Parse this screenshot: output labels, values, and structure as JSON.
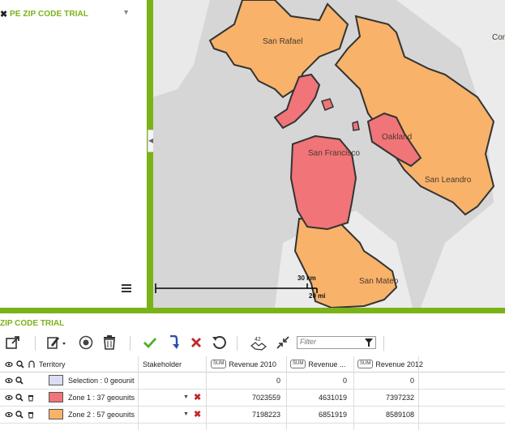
{
  "layer_panel": {
    "layer_name": "PE ZIP CODE TRIAL"
  },
  "map": {
    "labels": {
      "san_rafael": "San Rafael",
      "san_francisco": "San Francisco",
      "oakland": "Oakland",
      "san_leandro": "San Leandro",
      "san_mateo": "San Mateo",
      "concord_partial": "Con"
    },
    "scale": {
      "km": "30 km",
      "mi": "20 mi"
    },
    "colors": {
      "zone1": "#f07478",
      "zone2": "#f8b26a",
      "water": "#dcdcdc",
      "land": "#ececec"
    }
  },
  "bottom_panel": {
    "title": "ZIP CODE TRIAL",
    "filter_placeholder": "Filter",
    "grid": {
      "columns": [
        "Territory",
        "Stakeholder",
        "Revenue 2010",
        "Revenue ...",
        "Revenue 2012"
      ],
      "sum_badge": "SUM",
      "rows": [
        {
          "label": "Selection : 0 geounit",
          "color": "#dcdcf4",
          "rev2010": "0",
          "rev2011": "0",
          "rev2012": "0"
        },
        {
          "label": "Zone 1 : 37 geounits",
          "color": "#f07478",
          "rev2010": "7023559",
          "rev2011": "4631019",
          "rev2012": "7397232"
        },
        {
          "label": "Zone 2 : 57 geounits",
          "color": "#f8b26a",
          "rev2010": "7198223",
          "rev2011": "6851919",
          "rev2012": "8589108"
        }
      ]
    }
  }
}
